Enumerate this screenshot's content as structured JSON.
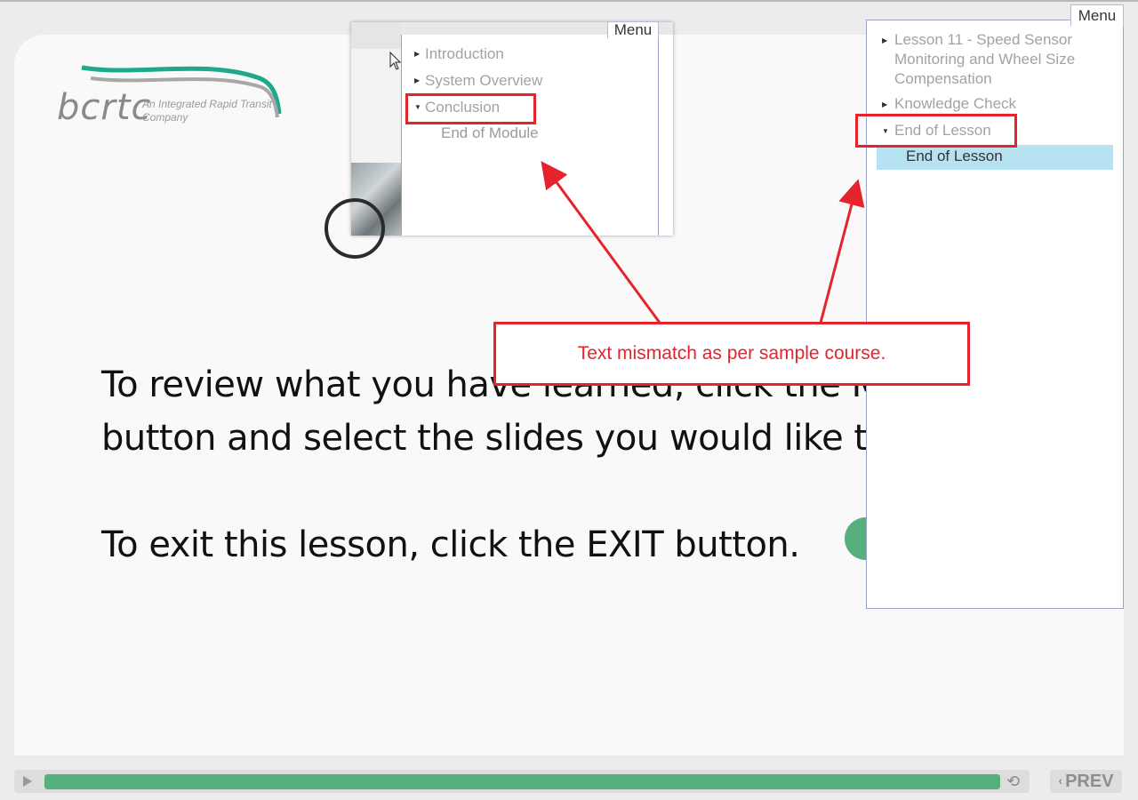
{
  "slide": {
    "logo_word": "bcrtc",
    "logo_tagline": "An Integrated Rapid Transit Company",
    "text_line1": "To review what you have learned, click the M",
    "text_line2": "button and select the slides you would like to",
    "text_line3": "To exit this lesson, click the EXIT button."
  },
  "left_menu": {
    "tab_label": "Menu",
    "items": [
      {
        "label": "Introduction",
        "arrow": "▶"
      },
      {
        "label": "System Overview",
        "arrow": "▶"
      },
      {
        "label": "Conclusion",
        "arrow": "▼"
      }
    ],
    "sub_items": [
      "End of Module"
    ]
  },
  "right_menu": {
    "tab_label": "Menu",
    "items": [
      {
        "label": "Lesson 11 - Speed Sensor Monitoring and Wheel Size Compensation",
        "arrow": "▶"
      },
      {
        "label": "Knowledge Check",
        "arrow": "▶"
      },
      {
        "label": "End of Lesson",
        "arrow": "▼"
      }
    ],
    "selected_sub_item": "End of Lesson"
  },
  "annotation": {
    "callout_text": "Text mismatch as per sample course.",
    "color": "#e5232c"
  },
  "player": {
    "progress_fraction": 1.0,
    "prev_label": "PREV",
    "accent_color": "#55b07d",
    "icons": [
      "play-icon",
      "replay-icon",
      "chevron-left-icon"
    ]
  }
}
